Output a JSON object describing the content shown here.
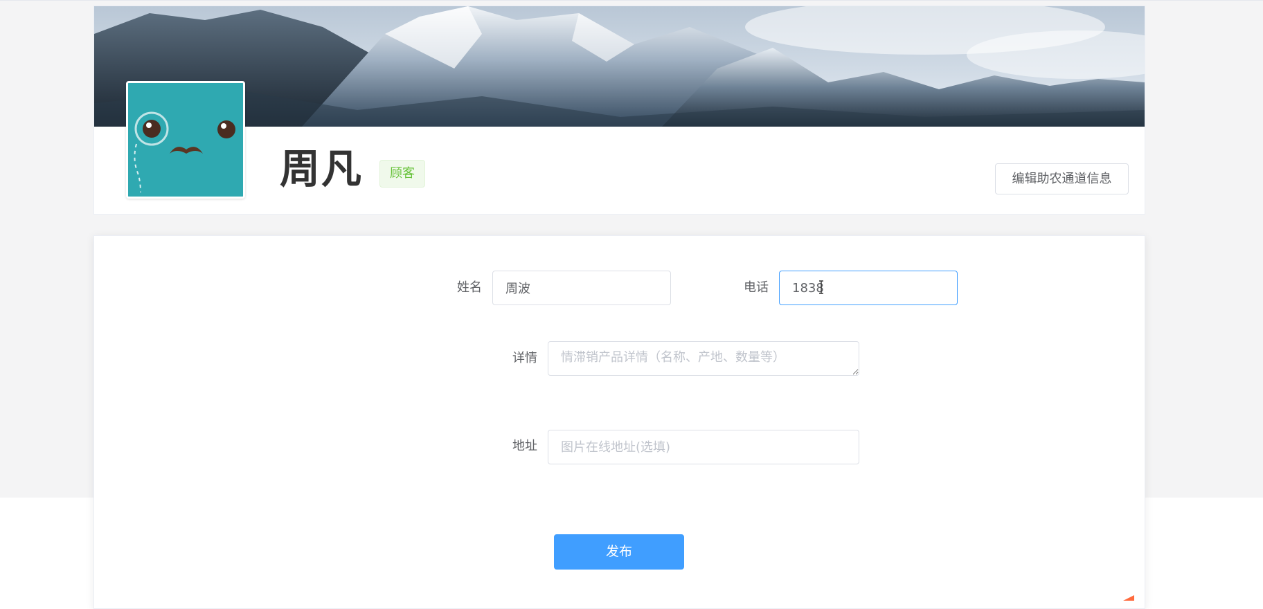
{
  "profile": {
    "name": "周凡",
    "role_tag": "顾客",
    "edit_button_label": "编辑助农通道信息"
  },
  "form": {
    "name_label": "姓名",
    "name_value": "周波",
    "phone_label": "电话",
    "phone_value": "1838",
    "details_label": "详情",
    "details_placeholder": "情滞销产品详情（名称、产地、数量等）",
    "address_label": "地址",
    "address_placeholder": "图片在线地址(选填)",
    "submit_label": "发布"
  },
  "icons": {
    "avatar": "monocle-mustache-avatar-icon",
    "cursor": "text-cursor-icon",
    "resize": "resize-handle-icon"
  },
  "colors": {
    "primary": "#409eff",
    "tag_green": "#67c23a",
    "avatar_teal": "#2fa9b1"
  }
}
